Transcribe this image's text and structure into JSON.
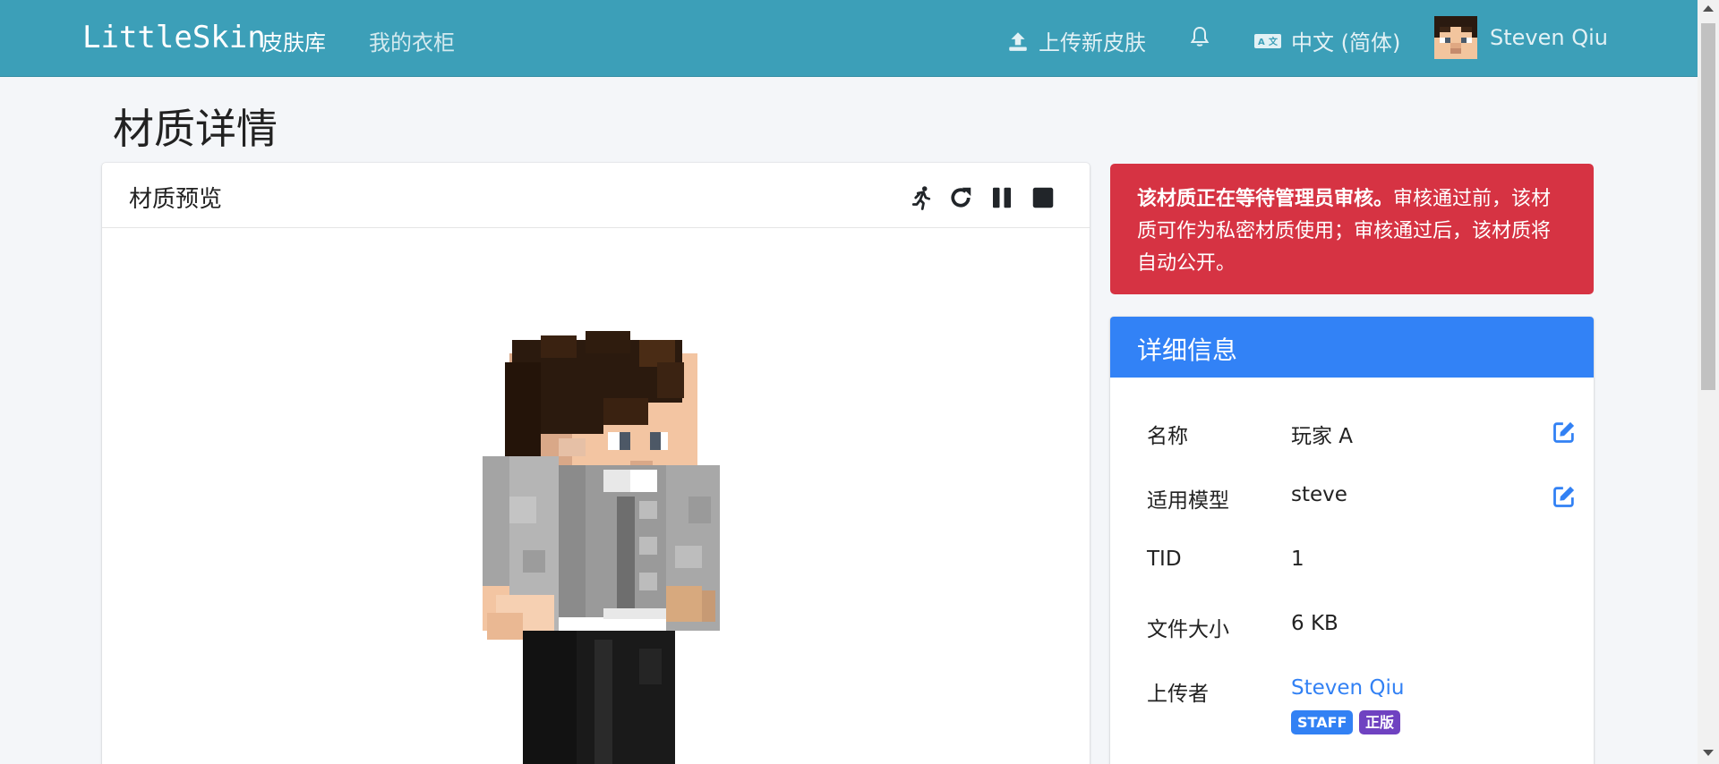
{
  "navbar": {
    "brand": "LittleSkin",
    "links": [
      "皮肤库",
      "我的衣柜"
    ],
    "upload_label": "上传新皮肤",
    "language_label": "中文 (简体)",
    "user_name": "Steven Qiu"
  },
  "page": {
    "title": "材质详情"
  },
  "preview": {
    "title": "材质预览",
    "tools": [
      "run-icon",
      "rotate-icon",
      "pause-icon",
      "stop-icon"
    ]
  },
  "alert": {
    "bold_text": "该材质正在等待管理员审核。",
    "text": "审核通过前，该材质可作为私密材质使用；审核通过后，该材质将自动公开。"
  },
  "details": {
    "title": "详细信息",
    "rows": [
      {
        "label": "名称",
        "value": "玩家 A"
      },
      {
        "label": "适用模型",
        "value": "steve"
      },
      {
        "label": "TID",
        "value": "1"
      },
      {
        "label": "文件大小",
        "value": "6 KB"
      },
      {
        "label": "上传者",
        "value": "Steven Qiu"
      }
    ],
    "badges": [
      {
        "label": "STAFF",
        "color": "#3281f4"
      },
      {
        "label": "正版",
        "color": "#6f42c1"
      }
    ]
  },
  "colors": {
    "navbar": "#3c9fb8",
    "alert": "#d63343",
    "info_header": "#3282f6"
  }
}
